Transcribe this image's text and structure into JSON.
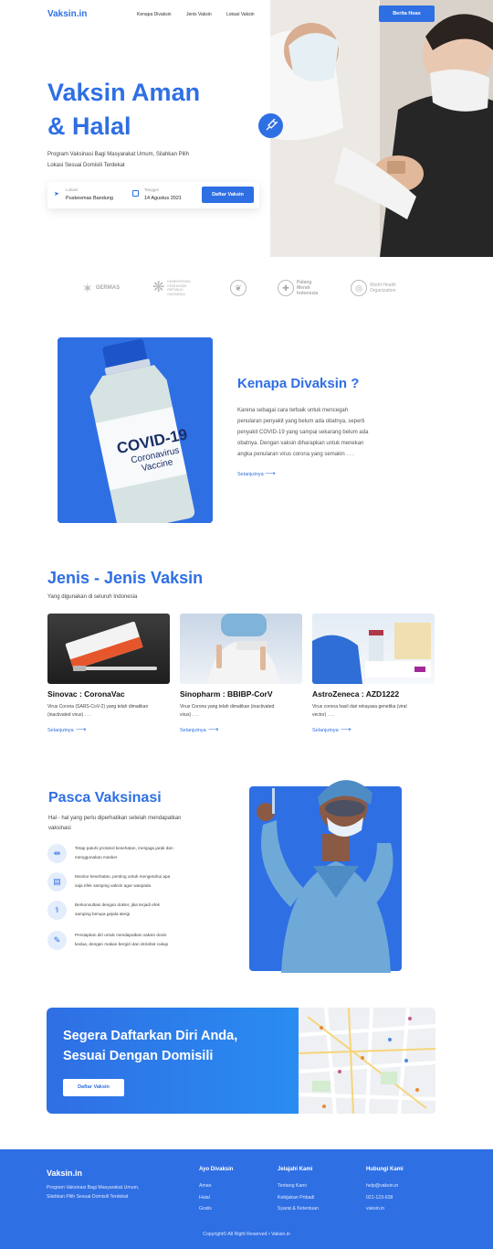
{
  "header": {
    "logo": "Vaksin.in",
    "nav": [
      "Kenapa Divaksin",
      "Jenis Vaksin",
      "Lokasi Vaksin"
    ],
    "hoax_button": "Berita Hoax"
  },
  "hero": {
    "title_line1": "Vaksin Aman",
    "title_line2": "& Halal",
    "subtitle_line1": "Program Vaksinasi Bagi Masyarakat Umum, Silahkan Pilih",
    "subtitle_line2": "Lokasi Sesuai Domisili Terdekat",
    "location_label": "Lokasi",
    "location_value": "Puskesmas Bandung",
    "date_label": "Tanggal",
    "date_value": "14 Agustus 2021",
    "register_button": "Daftar Vaksin"
  },
  "partners": [
    {
      "name": "GERMAS"
    },
    {
      "name_line1": "KEMENTERIAN",
      "name_line2": "KESEHATAN",
      "name_line3": "REPUBLIK",
      "name_line4": "INDONESIA"
    },
    {
      "name": ""
    },
    {
      "name_line1": "Palang",
      "name_line2": "Merah",
      "name_line3": "Indonesia"
    },
    {
      "name_line1": "World Health",
      "name_line2": "Organization"
    }
  ],
  "why": {
    "vial_line1": "COVID-19",
    "vial_line2": "Coronavirus",
    "vial_line3": "Vaccine",
    "title": "Kenapa Divaksin ?",
    "lines": [
      "Karena sebagai cara terbaik untuk mencegah",
      "penularan penyakit yang belum ada obatnya, seperti",
      "penyakit COVID-19 yang sampai sekarang belum ada",
      "obatnya. Dengan vaksin diharapkan untuk menekan",
      "angka penularan virus corona yang semakin . . ."
    ],
    "link": "Selanjutnya"
  },
  "vaccines": {
    "title": "Jenis - Jenis Vaksin",
    "subtitle": "Yang digunakan di seluruh Indonesia",
    "items": [
      {
        "name": "Sinovac : CoronaVac",
        "desc1": "Virus Corona (SARS-CoV-2) yang telah dimatikan",
        "desc2": "(inactivated virus) . . .",
        "link": "Selanjutnya"
      },
      {
        "name": "Sinopharm : BBIBP-CorV",
        "desc1": "Virus Corona yang telah dimatikan (inactivated",
        "desc2": "virus) . . .",
        "link": "Selanjutnya"
      },
      {
        "name": "AstroZeneca : AZD1222",
        "desc1": "Virus corona hasil dari rekayasa genetika (viral",
        "desc2": "vector) . . .",
        "link": "Selanjutnya"
      }
    ]
  },
  "pasca": {
    "title": "Pasca Vaksinasi",
    "subtitle_line1": "Hal - hal yang perlu diperhatikan setelah mendapatkan",
    "subtitle_line2": "vaksinasi",
    "steps": [
      {
        "l1": "Tetap patuhi protokol kesehatan, menjaga jarak dan",
        "l2": "menggunakan masker"
      },
      {
        "l1": "Monitor kesehatan, penting untuk mengetahui apa",
        "l2": "saja efek samping vaksin agar waspada"
      },
      {
        "l1": "Berkonsultasi dengan dokter, jika terjadi efek",
        "l2": "samping berupa gejala alergi"
      },
      {
        "l1": "Persiapkan diri untuk mendapatkan vaksin dosis",
        "l2": "kedua, dengan makan bergizi dan istirahat cukup"
      }
    ]
  },
  "cta": {
    "title_line1": "Segera Daftarkan Diri Anda,",
    "title_line2": "Sesuai Dengan Domisili",
    "button": "Daftar Vaksin"
  },
  "footer": {
    "brand": "Vaksin.in",
    "desc_line1": "Program Vaksinasi Bagi Masyarakat Umum,",
    "desc_line2": "Silahkan Pilih Sesuai Domisili Terdekat",
    "col1": {
      "title": "Ayo Divaksin",
      "items": [
        "Aman",
        "Halal",
        "Gratis"
      ]
    },
    "col2": {
      "title": "Jelajahi Kami",
      "items": [
        "Tentang Kami",
        "Kebijakan Pribadi",
        "Syarat & Ketentuan"
      ]
    },
    "col3": {
      "title": "Hubungi Kami",
      "items": [
        "help@vaksin.in",
        "021-123-638",
        "vaksin.in"
      ]
    },
    "copyright": "Copyright© All Right Reserved • Vaksin.in"
  },
  "colors": {
    "primary": "#2f6fe4",
    "footer": "#2f6fe4",
    "light_icon_bg": "#e3edfc"
  }
}
